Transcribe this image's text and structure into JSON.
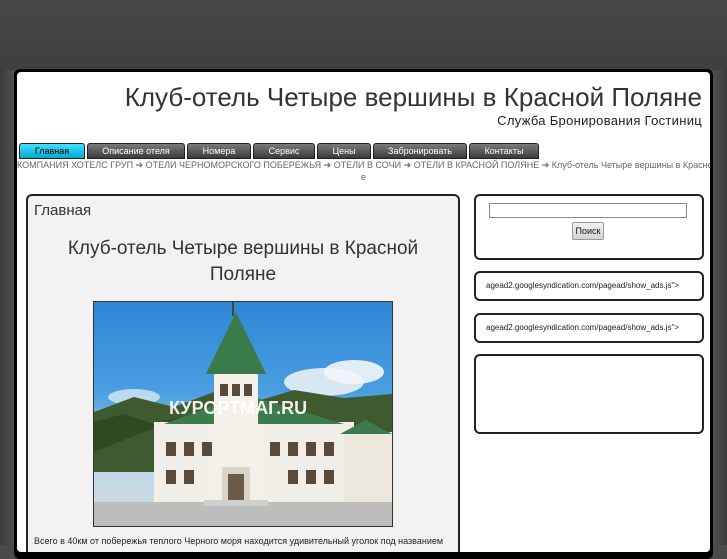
{
  "site": {
    "title": "Клуб-отель Четыре вершины в Красной Поляне",
    "subtitle": "Служба Бронирования Гостиниц"
  },
  "nav": {
    "items": [
      {
        "label": "Главная",
        "active": true
      },
      {
        "label": "Описание отеля"
      },
      {
        "label": "Номера"
      },
      {
        "label": "Сервис"
      },
      {
        "label": "Цены"
      },
      {
        "label": "Забронировать"
      },
      {
        "label": "Контакты"
      }
    ]
  },
  "breadcrumb": {
    "line1": "КОМПАНИЯ ХОТЕЛС ГРУП ➔ ОТЕЛИ ЧЕРНОМОРСКОГО ПОБЕРЕЖЬЯ ➔ ОТЕЛИ В СОЧИ ➔ ОТЕЛИ В КРАСНОЙ ПОЛЯНЕ ➔ Клуб-отель Четыре вершины в Красной Полян",
    "line2": "е"
  },
  "main": {
    "heading": "Главная",
    "article_title": "Клуб-отель Четыре вершины в Красной Поляне",
    "photo_watermark": "КУРОРТМАГ.RU",
    "text": "Всего в  40км от побережья теплого Черного моря находится удивительный уголок под названием"
  },
  "sidebar": {
    "search_button": "Поиск",
    "search_value": "",
    "ad1": "agead2.googlesyndication.com/pagead/show_ads.js\">",
    "ad2": "agead2.googlesyndication.com/pagead/show_ads.js\">"
  },
  "colors": {
    "active_tab": "#1ec8f0",
    "frame": "#000000",
    "background": "#4a4a4a"
  }
}
